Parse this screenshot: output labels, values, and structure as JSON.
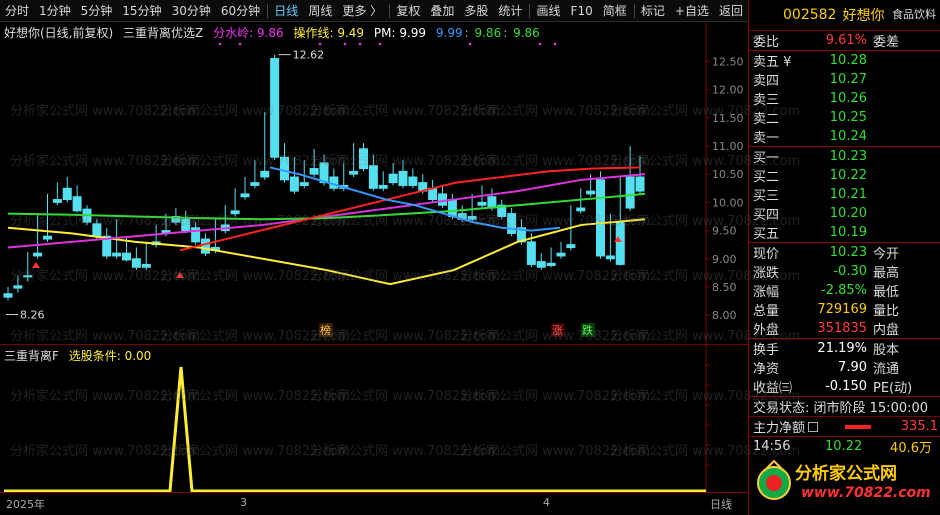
{
  "toolbar": {
    "items": [
      "分时",
      "1分钟",
      "5分钟",
      "15分钟",
      "30分钟",
      "60分钟",
      "日线",
      "周线",
      "更多 〉",
      "复权",
      "叠加",
      "多股",
      "统计",
      "画线",
      "F10",
      "简框",
      "标记",
      "+自选",
      "返回"
    ],
    "active": "日线"
  },
  "main": {
    "stock_label": "好想你(日线,前复权)",
    "formula_name": "三重背离优选Z",
    "fsl_label": "分水岭: 9.86",
    "czx_label": "操作线: 9.49",
    "pm_label": "PM: 9.99",
    "v1": "9.99",
    "v2": "9.86",
    "v3": "9.86",
    "high_label": "12.62",
    "low_label": "8.26",
    "tag_bang": "榜",
    "tag_zhang": "涨",
    "tag_die": "跌",
    "y_ticks": [
      "12.50",
      "12.00",
      "11.50",
      "11.00",
      "10.50",
      "10.00",
      "9.50",
      "9.00",
      "8.50",
      "8.00"
    ]
  },
  "indicator": {
    "name": "三重背离F",
    "label": "选股条件: 0.00"
  },
  "time_axis": {
    "labels": [
      "2025年",
      "3",
      "4"
    ],
    "right_label": "日线"
  },
  "panel": {
    "code": "002582",
    "name": "好想你",
    "industry": "食品饮料",
    "weibi_label": "委比",
    "weibi_value": "9.61%",
    "weicha_label": "委差",
    "sell": [
      {
        "label": "卖五",
        "flag": "¥",
        "price": "10.28"
      },
      {
        "label": "卖四",
        "flag": "",
        "price": "10.27"
      },
      {
        "label": "卖三",
        "flag": "",
        "price": "10.26"
      },
      {
        "label": "卖二",
        "flag": "",
        "price": "10.25"
      },
      {
        "label": "卖一",
        "flag": "",
        "price": "10.24"
      }
    ],
    "buy": [
      {
        "label": "买一",
        "price": "10.23"
      },
      {
        "label": "买二",
        "price": "10.22"
      },
      {
        "label": "买三",
        "price": "10.21"
      },
      {
        "label": "买四",
        "price": "10.20"
      },
      {
        "label": "买五",
        "price": "10.19"
      }
    ],
    "quote": [
      {
        "l": "现价",
        "v": "10.23",
        "r": "今开",
        "c": "green"
      },
      {
        "l": "涨跌",
        "v": "-0.30",
        "r": "最高",
        "c": "green"
      },
      {
        "l": "涨幅",
        "v": "-2.85%",
        "r": "最低",
        "c": "green"
      },
      {
        "l": "总量",
        "v": "729169",
        "r": "量比",
        "c": "yellow"
      },
      {
        "l": "外盘",
        "v": "351835",
        "r": "内盘",
        "c": "red"
      }
    ],
    "stats": [
      {
        "l": "换手",
        "v": "21.19%",
        "r": "股本"
      },
      {
        "l": "净资",
        "v": "7.90",
        "r": "流通"
      },
      {
        "l": "收益㈢",
        "v": "-0.150",
        "r": "PE(动)"
      }
    ],
    "trade_status": "交易状态: 闭市阶段 15:00:00",
    "main_flow_label": "主力净额",
    "main_flow_value": "335.1",
    "tick_time": "14:56",
    "tick_price": "10.22",
    "tick_vol": "40.6万",
    "brand_text": "分析家公式网",
    "brand_url": "www.70822.com"
  },
  "watermark_text": "分析家公式网 www.70822.com",
  "colors": {
    "up": "#ff3b3b",
    "down": "#55e0f0",
    "yellow": "#ffee33",
    "red_line": "#ff2222",
    "blue_line": "#3399ff",
    "magenta": "#dd33dd",
    "green_line": "#33dd33",
    "white_line": "#ffffff"
  },
  "chart_data": {
    "type": "candlestick",
    "ylim": [
      7.95,
      12.95
    ],
    "candles": [
      [
        8.38,
        8.5,
        8.32,
        8.26
      ],
      [
        8.52,
        8.7,
        8.48,
        8.4
      ],
      [
        8.7,
        9.12,
        8.68,
        8.6
      ],
      [
        9.1,
        9.8,
        9.05,
        9.0
      ],
      [
        9.4,
        10.15,
        9.35,
        9.3
      ],
      [
        10.05,
        10.35,
        10.0,
        9.95
      ],
      [
        10.25,
        10.45,
        10.05,
        10.0
      ],
      [
        10.1,
        10.3,
        9.85,
        9.82
      ],
      [
        9.88,
        9.95,
        9.65,
        9.6
      ],
      [
        9.62,
        9.7,
        9.4,
        9.35
      ],
      [
        9.4,
        9.55,
        9.05,
        9.0
      ],
      [
        9.1,
        9.7,
        9.05,
        9.0
      ],
      [
        9.1,
        9.4,
        8.98,
        8.95
      ],
      [
        9.0,
        9.2,
        8.85,
        8.8
      ],
      [
        8.9,
        9.3,
        8.85,
        8.8
      ],
      [
        9.3,
        9.6,
        9.25,
        9.2
      ],
      [
        9.5,
        9.8,
        9.45,
        9.4
      ],
      [
        9.75,
        9.9,
        9.65,
        9.6
      ],
      [
        9.7,
        9.85,
        9.5,
        9.45
      ],
      [
        9.55,
        9.65,
        9.3,
        9.25
      ],
      [
        9.35,
        9.45,
        9.1,
        9.05
      ],
      [
        9.2,
        9.7,
        9.15,
        9.1
      ],
      [
        9.6,
        9.95,
        9.5,
        9.45
      ],
      [
        9.85,
        10.25,
        9.8,
        9.75
      ],
      [
        10.15,
        10.45,
        10.1,
        10.05
      ],
      [
        10.35,
        10.75,
        10.3,
        10.25
      ],
      [
        10.55,
        11.6,
        10.45,
        10.4
      ],
      [
        12.55,
        12.62,
        10.8,
        10.75
      ],
      [
        10.8,
        11.05,
        10.4,
        10.35
      ],
      [
        10.45,
        10.8,
        10.2,
        10.15
      ],
      [
        10.35,
        10.75,
        10.3,
        10.25
      ],
      [
        10.6,
        10.95,
        10.5,
        10.45
      ],
      [
        10.7,
        10.85,
        10.35,
        10.3
      ],
      [
        10.45,
        10.6,
        10.25,
        10.2
      ],
      [
        10.3,
        10.7,
        10.25,
        10.2
      ],
      [
        10.55,
        11.05,
        10.5,
        10.45
      ],
      [
        10.95,
        11.05,
        10.6,
        10.55
      ],
      [
        10.65,
        10.85,
        10.25,
        10.2
      ],
      [
        10.3,
        10.55,
        10.25,
        10.2
      ],
      [
        10.5,
        10.7,
        10.35,
        10.3
      ],
      [
        10.55,
        10.75,
        10.3,
        10.25
      ],
      [
        10.45,
        10.6,
        10.3,
        10.25
      ],
      [
        10.35,
        10.5,
        10.2,
        10.15
      ],
      [
        10.25,
        10.4,
        10.05,
        10.0
      ],
      [
        10.15,
        10.3,
        9.95,
        9.9
      ],
      [
        10.05,
        10.15,
        9.75,
        9.7
      ],
      [
        9.8,
        9.95,
        9.7,
        9.65
      ],
      [
        9.75,
        10.15,
        9.7,
        9.65
      ],
      [
        10.0,
        10.3,
        9.95,
        9.9
      ],
      [
        10.1,
        10.25,
        9.9,
        9.85
      ],
      [
        9.95,
        10.05,
        9.75,
        9.7
      ],
      [
        9.8,
        9.9,
        9.45,
        9.4
      ],
      [
        9.55,
        9.7,
        9.3,
        9.25
      ],
      [
        9.3,
        9.45,
        8.9,
        8.85
      ],
      [
        8.95,
        9.1,
        8.85,
        8.8
      ],
      [
        8.92,
        9.2,
        8.88,
        8.85
      ],
      [
        9.1,
        9.3,
        9.05,
        9.0
      ],
      [
        9.25,
        9.95,
        9.2,
        9.15
      ],
      [
        9.9,
        10.25,
        9.85,
        9.8
      ],
      [
        10.2,
        10.5,
        10.15,
        10.1
      ],
      [
        10.4,
        10.55,
        9.05,
        9.0
      ],
      [
        9.05,
        9.8,
        9.0,
        8.95
      ],
      [
        9.65,
        10.45,
        8.9,
        8.88
      ],
      [
        10.45,
        11.0,
        9.9,
        9.85
      ],
      [
        10.45,
        10.82,
        10.2,
        10.15
      ]
    ],
    "lines": {
      "red": [
        9.15,
        9.35,
        9.55,
        9.75,
        9.95,
        10.15,
        10.35,
        10.45,
        10.55,
        10.6,
        10.62
      ],
      "blue": [
        10.62,
        10.5,
        10.35,
        10.2,
        10.05,
        9.95,
        9.8,
        9.65,
        9.55,
        9.5,
        9.55
      ],
      "yellow": [
        9.55,
        9.45,
        9.3,
        9.2,
        9.0,
        8.8,
        8.55,
        8.8,
        9.3,
        9.6,
        9.7
      ],
      "magenta": [
        9.2,
        9.3,
        9.4,
        9.5,
        9.6,
        9.75,
        9.9,
        10.05,
        10.2,
        10.4,
        10.5
      ],
      "green": [
        9.8,
        9.78,
        9.75,
        9.72,
        9.7,
        9.72,
        9.78,
        9.85,
        9.95,
        10.05,
        10.15
      ]
    }
  }
}
